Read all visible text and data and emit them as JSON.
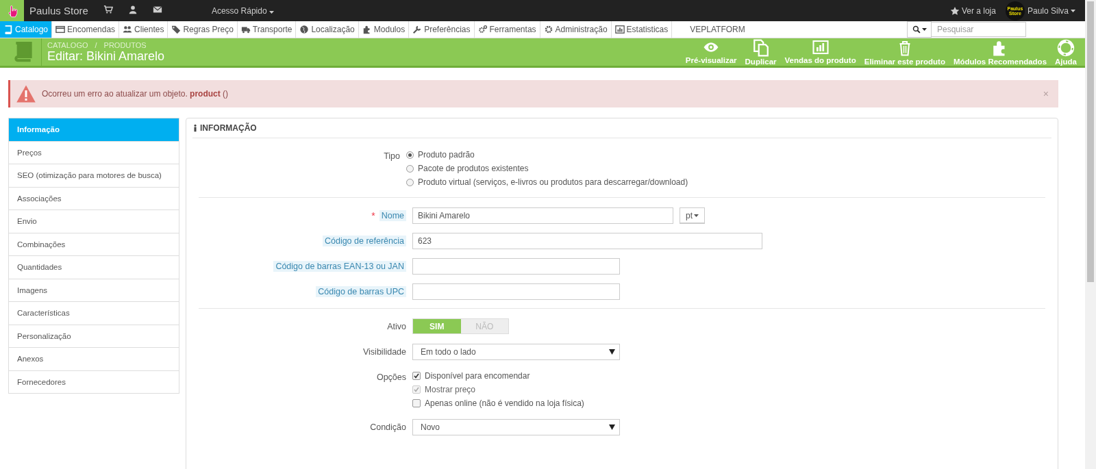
{
  "topbar": {
    "shop_name": "Paulus Store",
    "quick_access": "Acesso Rápido",
    "view_shop": "Ver a loja",
    "avatar_text": "Paulus Store",
    "user_name": "Paulo Silva"
  },
  "nav": {
    "items": [
      {
        "label": "Catalogo",
        "selected": true
      },
      {
        "label": "Encomendas",
        "selected": false
      },
      {
        "label": "Clientes",
        "selected": false
      },
      {
        "label": "Regras Preço",
        "selected": false
      },
      {
        "label": "Transporte",
        "selected": false
      },
      {
        "label": "Localização",
        "selected": false
      },
      {
        "label": "Modulos",
        "selected": false
      },
      {
        "label": "Preferências",
        "selected": false
      },
      {
        "label": "Ferramentas",
        "selected": false
      },
      {
        "label": "Administração",
        "selected": false
      },
      {
        "label": "Estatisticas",
        "selected": false
      }
    ],
    "extra": "VEPLATFORM",
    "search_placeholder": "Pesquisar"
  },
  "page_header": {
    "breadcrumb": [
      "CATALOGO",
      "PRODUTOS"
    ],
    "breadcrumb_separator": "/",
    "title": "Editar: Bikini Amarelo",
    "toolbar": [
      "Pré-visualizar",
      "Duplicar",
      "Vendas do produto",
      "Eliminar este produto",
      "Módulos Recomendados",
      "Ajuda"
    ]
  },
  "alert": {
    "message": "Ocorreu um erro ao atualizar um objeto. **product** ()",
    "close": "×"
  },
  "sidebar": {
    "items": [
      {
        "label": "Informação",
        "selected": true
      },
      {
        "label": "Preços",
        "selected": false
      },
      {
        "label": "SEO (otimização para motores de busca)",
        "selected": false
      },
      {
        "label": "Associações",
        "selected": false
      },
      {
        "label": "Envio",
        "selected": false
      },
      {
        "label": "Combinações",
        "selected": false
      },
      {
        "label": "Quantidades",
        "selected": false
      },
      {
        "label": "Imagens",
        "selected": false
      },
      {
        "label": "Características",
        "selected": false
      },
      {
        "label": "Personalização",
        "selected": false
      },
      {
        "label": "Anexos",
        "selected": false
      },
      {
        "label": "Fornecedores",
        "selected": false
      }
    ]
  },
  "panel": {
    "title": "INFORMAÇÃO",
    "sections": [
      [
        {
          "kind": "radio",
          "label": "Tipo",
          "options": [
            {
              "label": "Produto padrão",
              "selected": true
            },
            {
              "label": "Pacote de produtos existentes",
              "selected": false
            },
            {
              "label": "Produto virtual (serviços, e-livros ou produtos para descarregar/download)",
              "selected": false
            }
          ]
        }
      ],
      [
        {
          "kind": "text",
          "label": "Nome",
          "required_mark": "*",
          "help": true,
          "value": "Bikini Amarelo",
          "lang": "pt"
        },
        {
          "kind": "text",
          "label": "Código de referência",
          "help": true,
          "value": "623"
        },
        {
          "kind": "text",
          "label": "Código de barras EAN-13 ou JAN",
          "help": true
        },
        {
          "kind": "text",
          "label": "Código de barras UPC",
          "help": true
        }
      ],
      [
        {
          "kind": "switch",
          "label": "Ativo",
          "options": [
            {
              "label": "SIM",
              "selected": true
            },
            {
              "label": "NÃO",
              "selected": false
            }
          ]
        },
        {
          "kind": "select",
          "label": "Visibilidade",
          "value": "Em todo o lado"
        },
        {
          "kind": "checks",
          "label": "Opções",
          "options": [
            {
              "label": "Disponível para encomendar",
              "checked": true,
              "disabled": false
            },
            {
              "label": "Mostrar preço",
              "checked": true,
              "disabled": true
            },
            {
              "label": "Apenas online (não é vendido na loja física)",
              "checked": false,
              "disabled": false
            }
          ]
        },
        {
          "kind": "select",
          "label": "Condição",
          "value": "Novo"
        }
      ]
    ]
  }
}
